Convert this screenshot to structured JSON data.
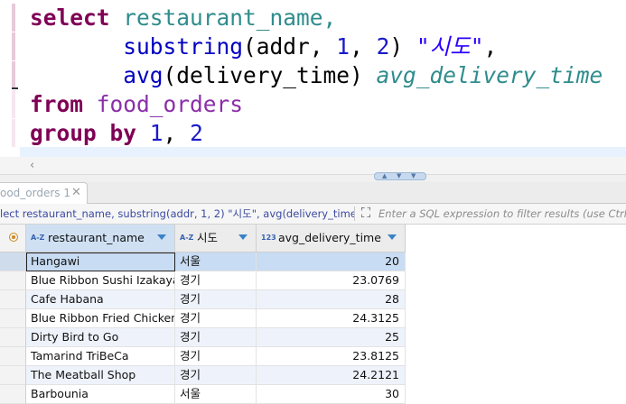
{
  "editor": {
    "line1": {
      "kw": "select",
      "rest": "restaurant_name,"
    },
    "line2": {
      "fn": "substring",
      "open": "(addr, ",
      "n1": "1",
      "sep": ", ",
      "n2": "2",
      "close": ") ",
      "str": "\"시도\"",
      "comma": ","
    },
    "line3": {
      "fn": "avg",
      "args": "(delivery_time) ",
      "alias": "avg_delivery_time"
    },
    "line4": {
      "kw": "from",
      "table": "food_orders"
    },
    "line5": {
      "kw": "group by",
      "n1": "1",
      "sep": ", ",
      "n2": "2"
    }
  },
  "results_tab": {
    "label": "ood_orders 1",
    "close_icon": "✕"
  },
  "filter_bar": {
    "query_text": "lect restaurant_name, substring(addr, 1, 2) \"시도\", avg(delivery_time) avg",
    "filter_icon": "expand-icon",
    "placeholder": "Enter a SQL expression to filter results (use Ctrl+Space)"
  },
  "grid": {
    "columns": [
      {
        "type_badge": "A-Z",
        "name": "restaurant_name"
      },
      {
        "type_badge": "A-Z",
        "name": "시도"
      },
      {
        "type_badge": "123",
        "name": "avg_delivery_time"
      }
    ],
    "rows": [
      {
        "restaurant_name": "Hangawi",
        "sido": "서울",
        "avg_delivery_time": "20"
      },
      {
        "restaurant_name": "Blue Ribbon Sushi Izakaya",
        "sido": "경기",
        "avg_delivery_time": "23.0769"
      },
      {
        "restaurant_name": "Cafe Habana",
        "sido": "경기",
        "avg_delivery_time": "28"
      },
      {
        "restaurant_name": "Blue Ribbon Fried Chicken",
        "sido": "경기",
        "avg_delivery_time": "24.3125"
      },
      {
        "restaurant_name": "Dirty Bird to Go",
        "sido": "경기",
        "avg_delivery_time": "25"
      },
      {
        "restaurant_name": "Tamarind TriBeCa",
        "sido": "경기",
        "avg_delivery_time": "23.8125"
      },
      {
        "restaurant_name": "The Meatball Shop",
        "sido": "경기",
        "avg_delivery_time": "24.2121"
      },
      {
        "restaurant_name": "Barbounia",
        "sido": "서울",
        "avg_delivery_time": "30"
      }
    ]
  },
  "colors": {
    "keyword": "#7f0055",
    "identifier": "#2f8c8c",
    "selection": "#c8dcf3"
  }
}
